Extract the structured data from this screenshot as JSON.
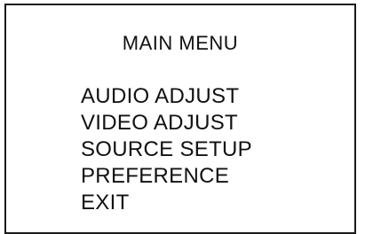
{
  "menu": {
    "title": "MAIN MENU",
    "items": [
      {
        "label": "AUDIO ADJUST"
      },
      {
        "label": "VIDEO ADJUST"
      },
      {
        "label": "SOURCE SETUP"
      },
      {
        "label": "PREFERENCE"
      },
      {
        "label": "EXIT"
      }
    ]
  }
}
